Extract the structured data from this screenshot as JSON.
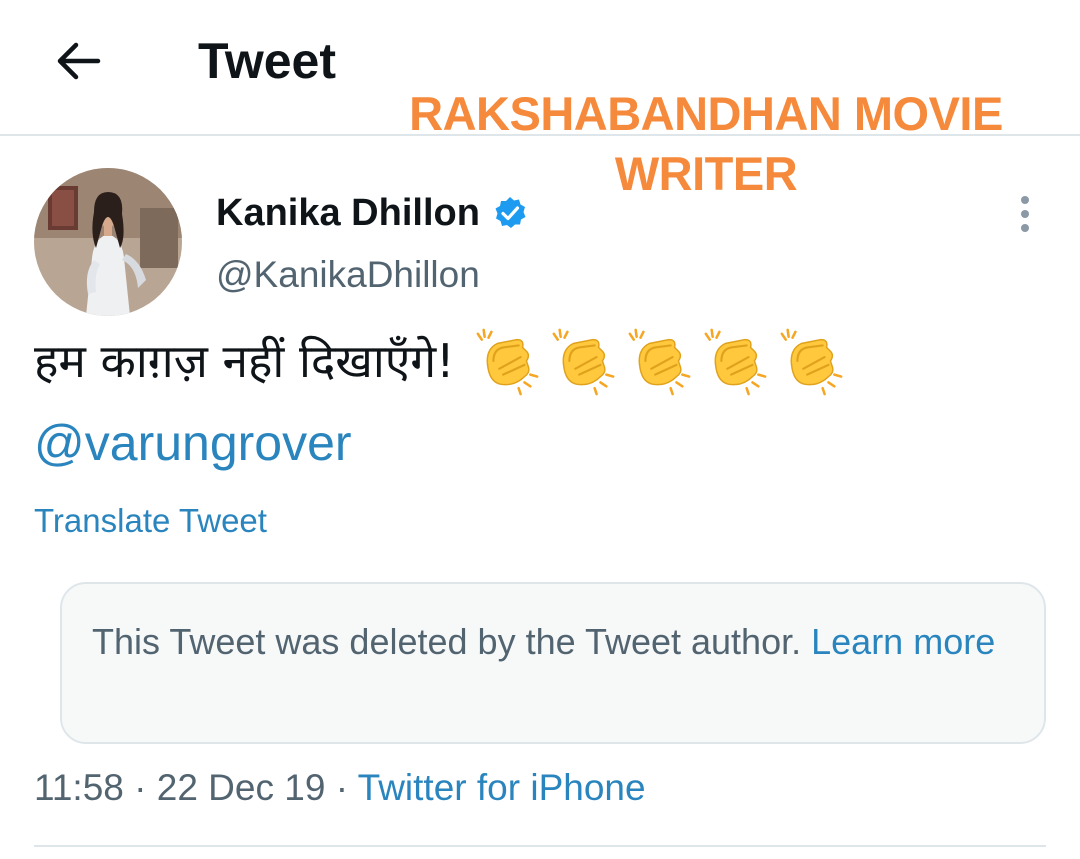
{
  "header": {
    "title": "Tweet",
    "back_icon": "arrow-left-icon"
  },
  "overlay": {
    "caption": "RAKSHABANDHAN MOVIE WRITER",
    "color": "#f58a3c"
  },
  "tweet": {
    "author": {
      "name": "Kanika Dhillon",
      "handle": "@KanikaDhillon",
      "verified": true,
      "avatar_icon": "user-avatar"
    },
    "text": "हम काग़ज़ नहीं दिखाएँगे!",
    "emoji": [
      "clapping-hands",
      "clapping-hands",
      "clapping-hands",
      "clapping-hands",
      "clapping-hands"
    ],
    "mention": "@varungrover",
    "translate_label": "Translate Tweet",
    "quoted": {
      "message": "This Tweet was deleted by the Tweet author.",
      "link_label": "Learn more"
    },
    "time": "11:58",
    "date": "22 Dec 19",
    "separator": "·",
    "source": "Twitter for iPhone"
  },
  "colors": {
    "link": "#2a85be",
    "secondary_text": "#536471",
    "divider": "#dfe6ea",
    "verified": "#1d9bf0"
  }
}
